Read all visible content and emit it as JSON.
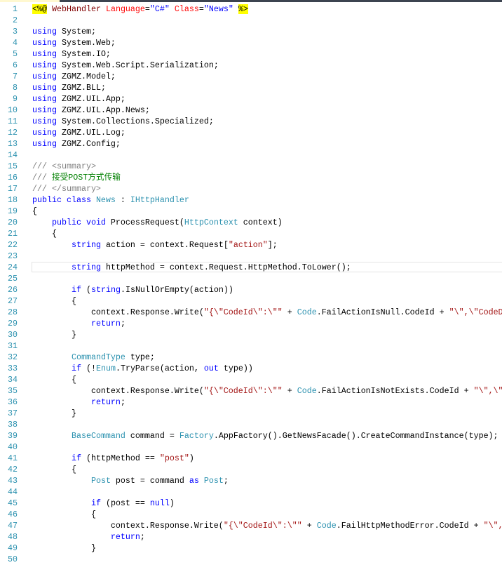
{
  "editor": {
    "colors": {
      "keyword": "#0000ff",
      "type": "#2b91af",
      "string": "#a31515",
      "comment": "#008000",
      "doc_comment": "#808080",
      "line_number": "#2b91af",
      "directive_highlight": "#ffff00"
    },
    "current_line": 24,
    "lines": [
      {
        "n": "1",
        "t": [
          [
            "dir",
            "<%@"
          ],
          [
            "pl",
            " "
          ],
          [
            "asp",
            "WebHandler"
          ],
          [
            "pl",
            " "
          ],
          [
            "at",
            "Language"
          ],
          [
            "pl",
            "="
          ],
          [
            "av",
            "\"C#\""
          ],
          [
            "pl",
            " "
          ],
          [
            "at",
            "Class"
          ],
          [
            "pl",
            "="
          ],
          [
            "av",
            "\"News\""
          ],
          [
            "pl",
            " "
          ],
          [
            "dir",
            "%>"
          ]
        ]
      },
      {
        "n": "2",
        "t": []
      },
      {
        "n": "3",
        "t": [
          [
            "kw",
            "using"
          ],
          [
            "pl",
            " System;"
          ]
        ]
      },
      {
        "n": "4",
        "t": [
          [
            "kw",
            "using"
          ],
          [
            "pl",
            " System.Web;"
          ]
        ]
      },
      {
        "n": "5",
        "t": [
          [
            "kw",
            "using"
          ],
          [
            "pl",
            " System.IO;"
          ]
        ]
      },
      {
        "n": "6",
        "t": [
          [
            "kw",
            "using"
          ],
          [
            "pl",
            " System.Web.Script.Serialization;"
          ]
        ]
      },
      {
        "n": "7",
        "t": [
          [
            "kw",
            "using"
          ],
          [
            "pl",
            " ZGMZ.Model;"
          ]
        ]
      },
      {
        "n": "8",
        "t": [
          [
            "kw",
            "using"
          ],
          [
            "pl",
            " ZGMZ.BLL;"
          ]
        ]
      },
      {
        "n": "9",
        "t": [
          [
            "kw",
            "using"
          ],
          [
            "pl",
            " ZGMZ.UIL.App;"
          ]
        ]
      },
      {
        "n": "10",
        "t": [
          [
            "kw",
            "using"
          ],
          [
            "pl",
            " ZGMZ.UIL.App.News;"
          ]
        ]
      },
      {
        "n": "11",
        "t": [
          [
            "kw",
            "using"
          ],
          [
            "pl",
            " System.Collections.Specialized;"
          ]
        ]
      },
      {
        "n": "12",
        "t": [
          [
            "kw",
            "using"
          ],
          [
            "pl",
            " ZGMZ.UIL.Log;"
          ]
        ]
      },
      {
        "n": "13",
        "t": [
          [
            "kw",
            "using"
          ],
          [
            "pl",
            " ZGMZ.Config;"
          ]
        ]
      },
      {
        "n": "14",
        "t": []
      },
      {
        "n": "15",
        "t": [
          [
            "dc",
            "/// <summary>"
          ]
        ]
      },
      {
        "n": "16",
        "t": [
          [
            "dc",
            "/// "
          ],
          [
            "cm",
            "接受POST方式传输"
          ]
        ]
      },
      {
        "n": "17",
        "t": [
          [
            "dc",
            "/// </summary>"
          ]
        ]
      },
      {
        "n": "18",
        "t": [
          [
            "kw",
            "public class "
          ],
          [
            "ty",
            "News"
          ],
          [
            "pl",
            " : "
          ],
          [
            "ty",
            "IHttpHandler"
          ]
        ]
      },
      {
        "n": "19",
        "t": [
          [
            "pl",
            "{"
          ]
        ]
      },
      {
        "n": "20",
        "t": [
          [
            "pl",
            "    "
          ],
          [
            "kw",
            "public void"
          ],
          [
            "pl",
            " ProcessRequest("
          ],
          [
            "ty",
            "HttpContext"
          ],
          [
            "pl",
            " context)"
          ]
        ]
      },
      {
        "n": "21",
        "t": [
          [
            "pl",
            "    {"
          ]
        ]
      },
      {
        "n": "22",
        "t": [
          [
            "pl",
            "        "
          ],
          [
            "kw",
            "string"
          ],
          [
            "pl",
            " action = context.Request["
          ],
          [
            "st",
            "\"action\""
          ],
          [
            "pl",
            "];"
          ]
        ]
      },
      {
        "n": "23",
        "t": []
      },
      {
        "n": "24",
        "t": [
          [
            "pl",
            "        "
          ],
          [
            "kw",
            "string"
          ],
          [
            "pl",
            " httpMethod = context.Request.HttpMethod.ToLower();"
          ]
        ]
      },
      {
        "n": "25",
        "t": []
      },
      {
        "n": "26",
        "t": [
          [
            "pl",
            "        "
          ],
          [
            "kw",
            "if"
          ],
          [
            "pl",
            " ("
          ],
          [
            "kw",
            "string"
          ],
          [
            "pl",
            ".IsNullOrEmpty(action))"
          ]
        ]
      },
      {
        "n": "27",
        "t": [
          [
            "pl",
            "        {"
          ]
        ]
      },
      {
        "n": "28",
        "t": [
          [
            "pl",
            "            context.Response.Write("
          ],
          [
            "st",
            "\"{\\\"CodeId\\\":\\\"\""
          ],
          [
            "pl",
            " + "
          ],
          [
            "ty",
            "Code"
          ],
          [
            "pl",
            ".FailActionIsNull.CodeId + "
          ],
          [
            "st",
            "\"\\\",\\\"CodeD"
          ]
        ]
      },
      {
        "n": "29",
        "t": [
          [
            "pl",
            "            "
          ],
          [
            "kw",
            "return"
          ],
          [
            "pl",
            ";"
          ]
        ]
      },
      {
        "n": "30",
        "t": [
          [
            "pl",
            "        }"
          ]
        ]
      },
      {
        "n": "31",
        "t": []
      },
      {
        "n": "32",
        "t": [
          [
            "pl",
            "        "
          ],
          [
            "ty",
            "CommandType"
          ],
          [
            "pl",
            " type;"
          ]
        ]
      },
      {
        "n": "33",
        "t": [
          [
            "pl",
            "        "
          ],
          [
            "kw",
            "if"
          ],
          [
            "pl",
            " (!"
          ],
          [
            "ty",
            "Enum"
          ],
          [
            "pl",
            ".TryParse(action, "
          ],
          [
            "kw",
            "out"
          ],
          [
            "pl",
            " type))"
          ]
        ]
      },
      {
        "n": "34",
        "t": [
          [
            "pl",
            "        {"
          ]
        ]
      },
      {
        "n": "35",
        "t": [
          [
            "pl",
            "            context.Response.Write("
          ],
          [
            "st",
            "\"{\\\"CodeId\\\":\\\"\""
          ],
          [
            "pl",
            " + "
          ],
          [
            "ty",
            "Code"
          ],
          [
            "pl",
            ".FailActionIsNotExists.CodeId + "
          ],
          [
            "st",
            "\"\\\",\\\""
          ]
        ]
      },
      {
        "n": "36",
        "t": [
          [
            "pl",
            "            "
          ],
          [
            "kw",
            "return"
          ],
          [
            "pl",
            ";"
          ]
        ]
      },
      {
        "n": "37",
        "t": [
          [
            "pl",
            "        }"
          ]
        ]
      },
      {
        "n": "38",
        "t": []
      },
      {
        "n": "39",
        "t": [
          [
            "pl",
            "        "
          ],
          [
            "ty",
            "BaseCommand"
          ],
          [
            "pl",
            " command = "
          ],
          [
            "ty",
            "Factory"
          ],
          [
            "pl",
            ".AppFactory().GetNewsFacade().CreateCommandInstance(type);"
          ]
        ]
      },
      {
        "n": "40",
        "t": []
      },
      {
        "n": "41",
        "t": [
          [
            "pl",
            "        "
          ],
          [
            "kw",
            "if"
          ],
          [
            "pl",
            " (httpMethod == "
          ],
          [
            "st",
            "\"post\""
          ],
          [
            "pl",
            ")"
          ]
        ]
      },
      {
        "n": "42",
        "t": [
          [
            "pl",
            "        {"
          ]
        ]
      },
      {
        "n": "43",
        "t": [
          [
            "pl",
            "            "
          ],
          [
            "ty",
            "Post"
          ],
          [
            "pl",
            " post = command "
          ],
          [
            "kw",
            "as"
          ],
          [
            "pl",
            " "
          ],
          [
            "ty",
            "Post"
          ],
          [
            "pl",
            ";"
          ]
        ]
      },
      {
        "n": "44",
        "t": []
      },
      {
        "n": "45",
        "t": [
          [
            "pl",
            "            "
          ],
          [
            "kw",
            "if"
          ],
          [
            "pl",
            " (post == "
          ],
          [
            "kw",
            "null"
          ],
          [
            "pl",
            ")"
          ]
        ]
      },
      {
        "n": "46",
        "t": [
          [
            "pl",
            "            {"
          ]
        ]
      },
      {
        "n": "47",
        "t": [
          [
            "pl",
            "                context.Response.Write("
          ],
          [
            "st",
            "\"{\\\"CodeId\\\":\\\"\""
          ],
          [
            "pl",
            " + "
          ],
          [
            "ty",
            "Code"
          ],
          [
            "pl",
            ".FailHttpMethodError.CodeId + "
          ],
          [
            "st",
            "\"\\\","
          ]
        ]
      },
      {
        "n": "48",
        "t": [
          [
            "pl",
            "                "
          ],
          [
            "kw",
            "return"
          ],
          [
            "pl",
            ";"
          ]
        ]
      },
      {
        "n": "49",
        "t": [
          [
            "pl",
            "            }"
          ]
        ]
      },
      {
        "n": "50",
        "t": []
      }
    ]
  }
}
